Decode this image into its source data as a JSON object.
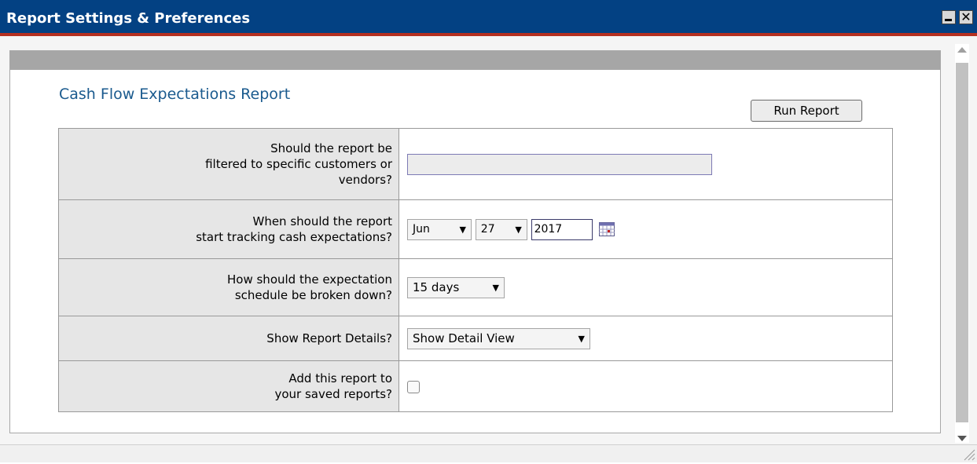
{
  "window": {
    "title": "Report Settings & Preferences",
    "minimize_icon": "minimize-icon",
    "close_icon": "close-icon",
    "close_glyph": "✕"
  },
  "report": {
    "title": "Cash Flow Expectations Report",
    "run_label": "Run Report",
    "rows": [
      {
        "label_lines": [
          "Should the report be",
          "filtered to specific customers or",
          "vendors?"
        ],
        "input_value": ""
      },
      {
        "label_lines": [
          "When should the report",
          "start tracking cash expectations?"
        ],
        "month": "Jun",
        "day": "27",
        "year": "2017",
        "calendar_icon": "calendar-icon"
      },
      {
        "label_lines": [
          "How should the expectation",
          "schedule be broken down?"
        ],
        "schedule": "15 days"
      },
      {
        "label_lines": [
          "Show Report Details?"
        ],
        "detail": "Show Detail View"
      },
      {
        "label_lines": [
          "Add this report to",
          "your saved reports?"
        ],
        "saved": false
      }
    ]
  },
  "colors": {
    "titlebar": "#034183",
    "title_text": "#1a5a8e",
    "label_bg": "#e6e6e6",
    "band": "#a6a6a6"
  }
}
